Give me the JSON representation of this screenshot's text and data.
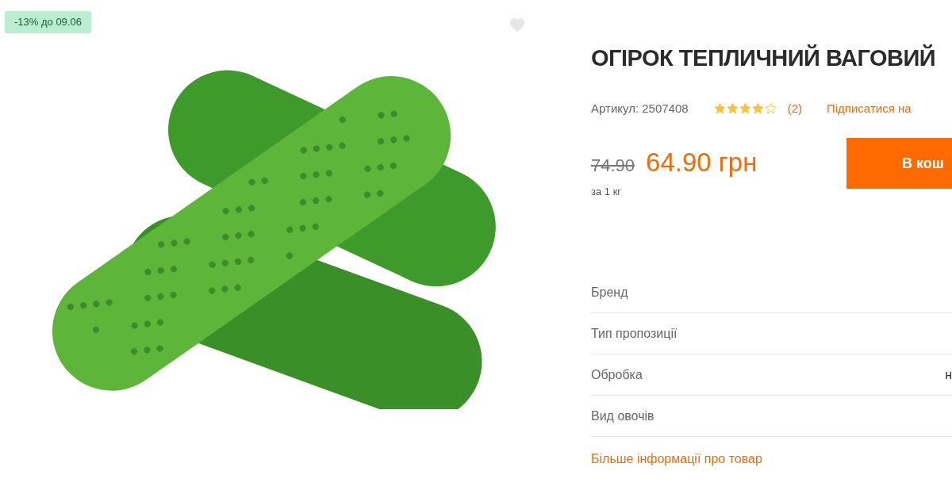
{
  "badge": "-13% до 09.06",
  "favorite": {
    "selected": false
  },
  "product": {
    "title": "ОГІРОК ТЕПЛИЧНИЙ ВАГОВИЙ",
    "sku": "Артикул: 2507408",
    "stars": 4,
    "reviews": "(2)",
    "subscribe": "Підписатися на"
  },
  "price": {
    "old": "74.90",
    "current": "64.90 грн",
    "unit": "за 1 кг",
    "cart_button": "В кош"
  },
  "specs": [
    {
      "label": "Бренд"
    },
    {
      "label": "Тип пропозиції"
    },
    {
      "label": "Обробка",
      "value": "н"
    },
    {
      "label": "Вид овочів"
    }
  ],
  "more_link": "Більше інформації про товар"
}
